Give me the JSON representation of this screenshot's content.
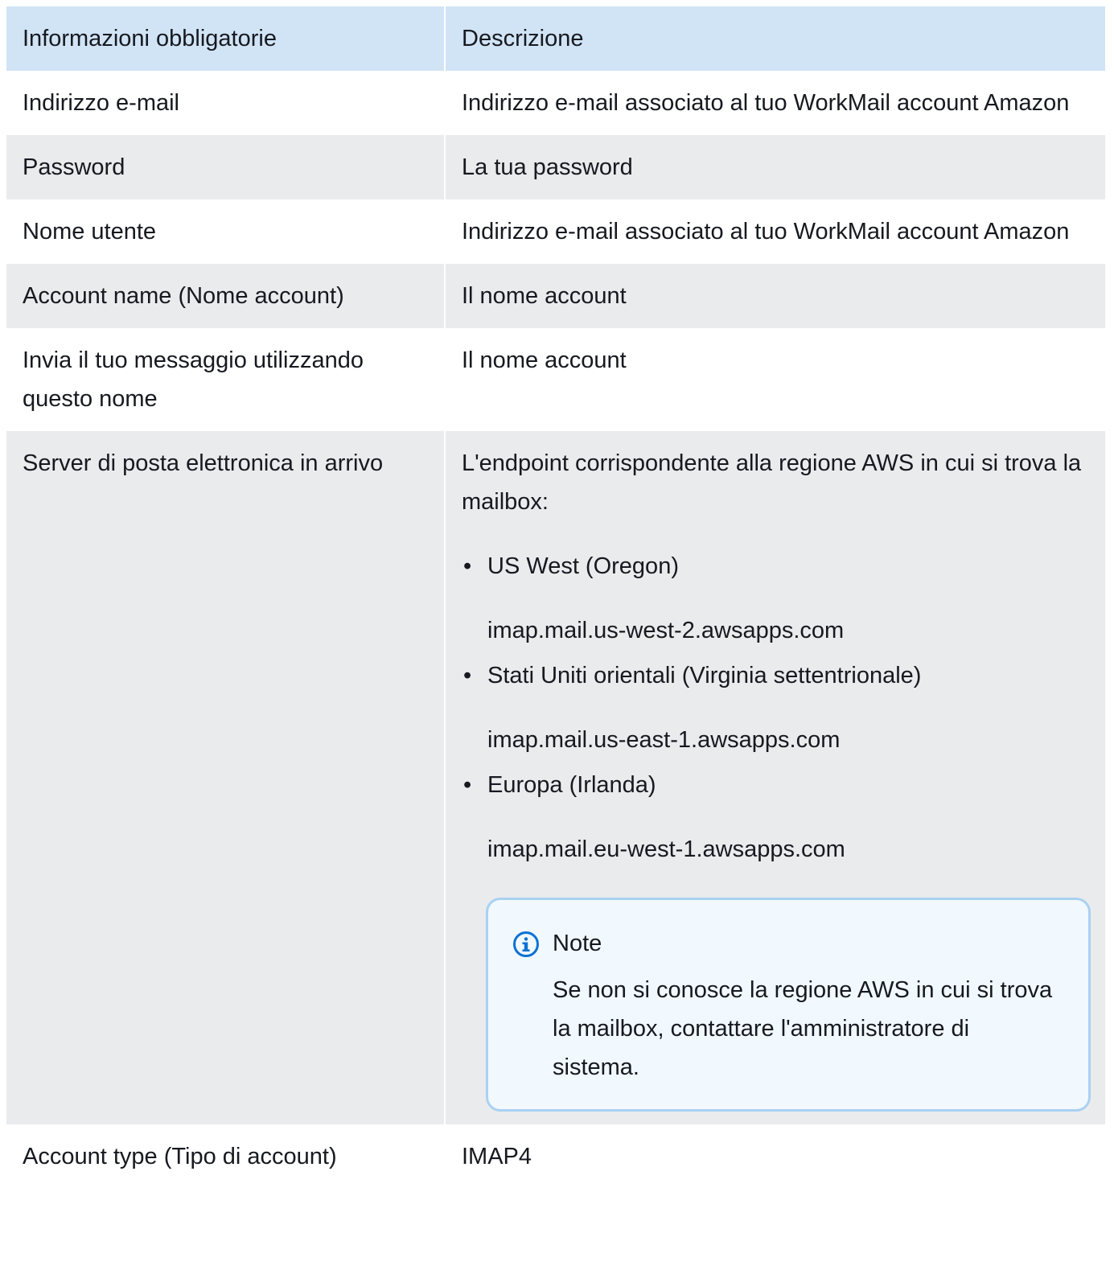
{
  "table": {
    "headers": [
      "Informazioni obbligatorie",
      "Descrizione"
    ],
    "rows": [
      {
        "field": "Indirizzo e-mail",
        "description": "Indirizzo e-mail associato al tuo WorkMail account Amazon"
      },
      {
        "field": "Password",
        "description": "La tua password"
      },
      {
        "field": "Nome utente",
        "description": "Indirizzo e-mail associato al tuo WorkMail account Amazon"
      },
      {
        "field": "Account name (Nome account)",
        "description": "Il nome account"
      },
      {
        "field": "Invia il tuo messaggio utilizzando questo nome",
        "description": "Il nome account"
      },
      {
        "field": "Server di posta elettronica in arrivo",
        "description": "L'endpoint corrispondente alla regione AWS in cui si trova la mailbox:",
        "regions": [
          {
            "name": "US West (Oregon)",
            "endpoint": "imap.mail.us-west-2.awsapps.com"
          },
          {
            "name": "Stati Uniti orientali (Virginia settentrionale)",
            "endpoint": "imap.mail.us-east-1.awsapps.com"
          },
          {
            "name": "Europa (Irlanda)",
            "endpoint": "imap.mail.eu-west-1.awsapps.com"
          }
        ],
        "note": {
          "title": "Note",
          "text": "Se non si conosce la regione AWS in cui si trova la mailbox, contattare l'amministratore di sistema.",
          "icon": "info-icon"
        }
      },
      {
        "field": "Account type (Tipo di account)",
        "description": "IMAP4"
      }
    ]
  },
  "colors": {
    "header_bg": "#d1e4f6",
    "alt_row_bg": "#eaebed",
    "note_bg": "#f1f8fe",
    "note_border": "#a9d1f2",
    "info_icon": "#0972d3",
    "text": "#16191f"
  }
}
